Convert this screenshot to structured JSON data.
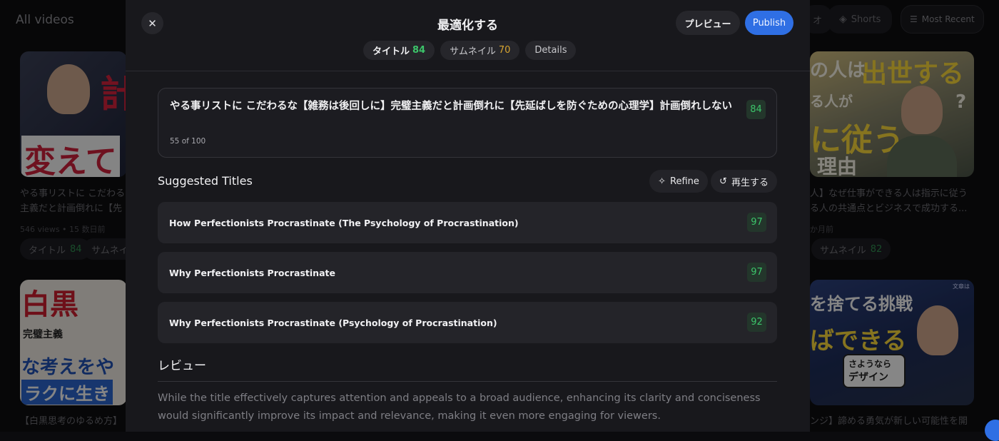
{
  "background": {
    "title": "All videos",
    "filter_chips": [
      {
        "icon": "",
        "label": "オ"
      },
      {
        "icon": "shorts-icon",
        "label": "Shorts"
      },
      {
        "icon": "sort-icon",
        "label": "Most Recent"
      }
    ],
    "cards": [
      {
        "thumb_text": [
          "計",
          "変えて"
        ],
        "title": "やる事リストに こだわる",
        "title_line2": "主義だと計画倒れに【先",
        "meta": "546 views • 15 数日前",
        "chips": [
          {
            "label": "タイトル",
            "score": "84"
          },
          {
            "label": "サムネイル",
            "score": ""
          }
        ]
      },
      {
        "thumb_text": [
          "白黒",
          "完璧主義",
          "な考えをや",
          "ラクに生き"
        ],
        "title": "【白黒思考のゆるめ方】"
      },
      {
        "thumb_text": [
          "の人は",
          "出世する",
          "る人が",
          "に従う",
          "理由",
          "?"
        ],
        "title": "人】なぜ仕事ができる人は指示に従う",
        "title_line2": "る人の共通点とビジネスで成功する...",
        "meta": "か月前",
        "chips": [
          {
            "label": "サムネイル",
            "score": "82"
          }
        ]
      },
      {
        "thumb_text": [
          "を捨てる挑戦",
          "ばできる",
          "さようなら",
          "デザイン",
          "文章は"
        ],
        "title": "ンジ】諦める勇気が新しい可能性を開"
      }
    ]
  },
  "modal": {
    "close_icon": "close-icon",
    "title": "最適化する",
    "preview_label": "プレビュー",
    "publish_label": "Publish",
    "tabs": [
      {
        "label": "タイトル",
        "score": "84",
        "score_color": "#3cc46a"
      },
      {
        "label": "サムネイル",
        "score": "70",
        "score_color": "#d8a531"
      },
      {
        "label": "Details",
        "score": ""
      }
    ],
    "current_title": {
      "text": "やる事リストに こだわるな【雑務は後回しに】完璧主義だと計画倒れに【先延ばしを防ぐための心理学】計画倒れしない",
      "char_count": "55 of 100",
      "score": "84"
    },
    "suggested": {
      "heading": "Suggested Titles",
      "refine_label": "Refine",
      "refine_icon": "sparkle-icon",
      "regenerate_label": "再生する",
      "regenerate_icon": "history-icon",
      "items": [
        {
          "text": "How Perfectionists Procrastinate (The Psychology of Procrastination)",
          "score": "97"
        },
        {
          "text": "Why Perfectionists Procrastinate",
          "score": "97"
        },
        {
          "text": "Why Perfectionists Procrastinate (Psychology of Procrastination)",
          "score": "92"
        }
      ]
    },
    "review": {
      "heading": "レビュー",
      "text": "While the title effectively captures attention and appeals to a broad audience, enhancing its clarity and conciseness would significantly improve its impact and relevance, making it even more engaging for viewers."
    }
  },
  "colors": {
    "accent": "#2f6fe4",
    "score_green": "#3cc46a",
    "score_yellow": "#d8a531",
    "modal_bg": "#18181c"
  }
}
